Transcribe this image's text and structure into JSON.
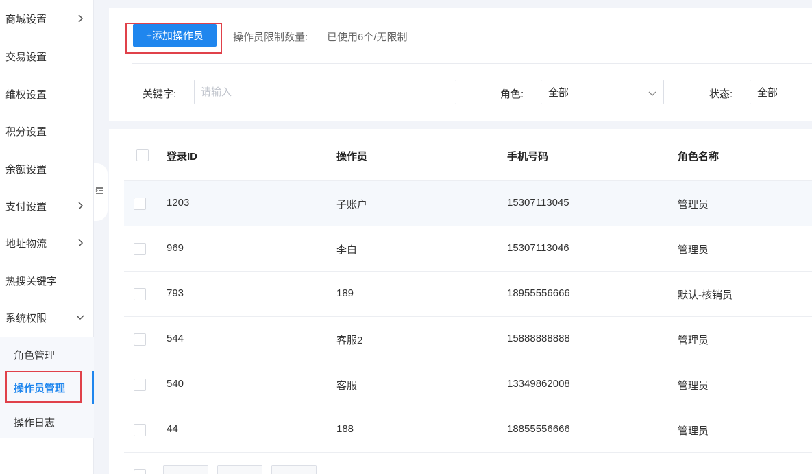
{
  "sidebar": {
    "items": [
      {
        "label": "商城设置",
        "arrow": "right"
      },
      {
        "label": "交易设置",
        "arrow": ""
      },
      {
        "label": "维权设置",
        "arrow": ""
      },
      {
        "label": "积分设置",
        "arrow": ""
      },
      {
        "label": "余额设置",
        "arrow": ""
      },
      {
        "label": "支付设置",
        "arrow": "right"
      },
      {
        "label": "地址物流",
        "arrow": "right"
      },
      {
        "label": "热搜关键字",
        "arrow": ""
      },
      {
        "label": "系统权限",
        "arrow": "down"
      }
    ],
    "submenu": [
      {
        "label": "角色管理",
        "active": false
      },
      {
        "label": "操作员管理",
        "active": true
      },
      {
        "label": "操作日志",
        "active": false
      }
    ]
  },
  "toolbar": {
    "add_label": "+添加操作员",
    "limit_label": "操作员限制数量:",
    "limit_value": "已使用6个/无限制"
  },
  "filters": {
    "keyword_label": "关键字:",
    "keyword_placeholder": "请输入",
    "role_label": "角色:",
    "role_value": "全部",
    "status_label": "状态:",
    "status_value": "全部"
  },
  "table": {
    "columns": [
      "登录ID",
      "操作员",
      "手机号码",
      "角色名称"
    ],
    "rows": [
      {
        "id": "1203",
        "name": "子账户",
        "phone": "15307113045",
        "role": "管理员"
      },
      {
        "id": "969",
        "name": "李白",
        "phone": "15307113046",
        "role": "管理员"
      },
      {
        "id": "793",
        "name": "189",
        "phone": "18955556666",
        "role": "默认-核销员"
      },
      {
        "id": "544",
        "name": "客服2",
        "phone": "15888888888",
        "role": "管理员"
      },
      {
        "id": "540",
        "name": "客服",
        "phone": "13349862008",
        "role": "管理员"
      },
      {
        "id": "44",
        "name": "188",
        "phone": "18855556666",
        "role": "管理员"
      }
    ]
  },
  "colors": {
    "accent": "#1f86ee",
    "highlight_box": "#e0414a"
  }
}
